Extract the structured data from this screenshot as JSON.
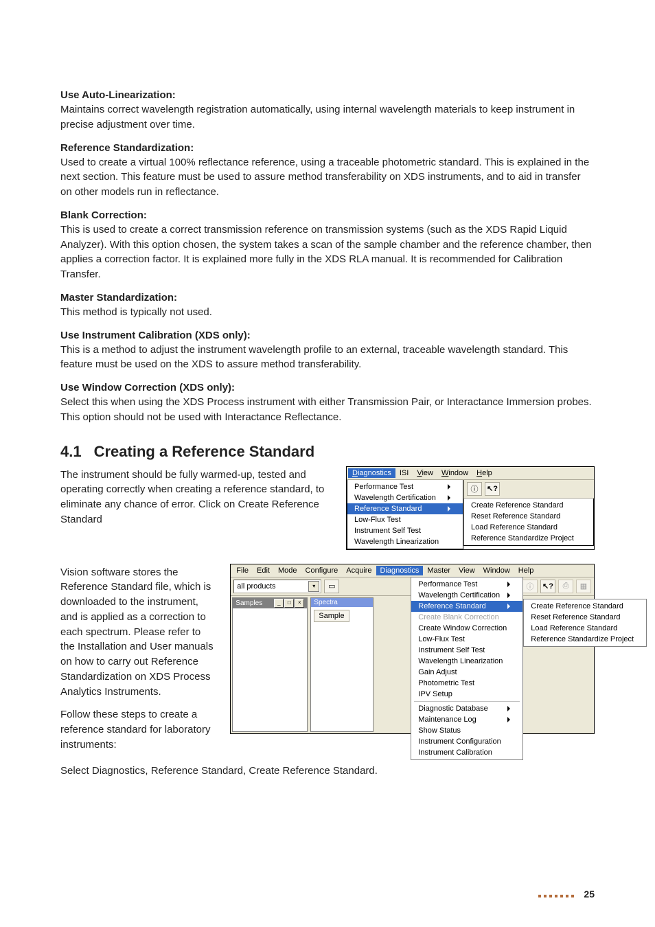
{
  "sections": {
    "auto_lin": {
      "head": "Use Auto-Linearization:",
      "body": "Maintains correct wavelength registration automatically, using internal wavelength materials to keep instrument in precise adjustment over time."
    },
    "ref_std_hdr": {
      "head": "Reference Standardization:",
      "body": "Used to create a virtual 100% reflectance reference, using a traceable photometric standard. This is explained in the next section. This feature must be used to assure method transferability on XDS instruments, and to aid in transfer on other models run in reflectance."
    },
    "blank": {
      "head": "Blank Correction:",
      "body": "This is used to create a correct transmission reference on transmission systems (such as the XDS Rapid Liquid Analyzer). With this option chosen, the system takes a scan of the sample chamber and the reference chamber, then applies a correction factor. It is explained more fully in the XDS RLA manual. It is recommended for Calibration Transfer."
    },
    "master": {
      "head": "Master Standardization:",
      "body": "This method is typically not used."
    },
    "inst_cal": {
      "head": "Use Instrument Calibration (XDS only):",
      "body": "This is a method to adjust the instrument wavelength profile to an external, traceable wavelength standard. This feature must be used on the XDS to assure method transferability."
    },
    "win_cor": {
      "head": "Use Window Correction (XDS only):",
      "body": "Select this when using the XDS Process instrument with either Transmission Pair, or Interactance Immersion probes. This option should not be used with Interactance Reflectance."
    }
  },
  "heading": {
    "num": "4.1",
    "title": "Creating a Reference Standard"
  },
  "para41a": "The instrument should be fully warmed-up, tested and operating correctly when creating a reference standard, to eliminate any chance of error. Click on Create Reference Standard",
  "para41b": "Vision software stores the Reference Standard file, which is downloaded to the instrument, and is applied as a correction to each spectrum. Please refer to the Installation and User manuals on how to carry out Reference Standardization on XDS Process Analytics Instruments.",
  "para41c": "Follow these steps to create a reference standard for laboratory instruments:",
  "para41d": "Select Diagnostics, Reference Standard, Create Reference Standard.",
  "fig1": {
    "menubar": [
      "Diagnostics",
      "ISI",
      "View",
      "Window",
      "Help"
    ],
    "menubar_ul": [
      "D",
      "",
      "V",
      "W",
      "H"
    ],
    "tb_icons": [
      "info-icon",
      "help-pointer-icon"
    ],
    "left_items": [
      {
        "label": "Performance Test",
        "arrow": true
      },
      {
        "label": "Wavelength Certification",
        "arrow": true
      },
      {
        "label": "Reference Standard",
        "arrow": true,
        "sel": true
      },
      {
        "label": "Low-Flux Test"
      },
      {
        "label": "Instrument Self Test"
      },
      {
        "label": "Wavelength Linearization"
      }
    ],
    "right_items": [
      "Create Reference Standard",
      "Reset Reference Standard",
      "Load Reference Standard",
      "Reference Standardize Project"
    ]
  },
  "fig2": {
    "menubar": [
      "File",
      "Edit",
      "Mode",
      "Configure",
      "Acquire",
      "Diagnostics",
      "Master",
      "View",
      "Window",
      "Help"
    ],
    "combo": "all products",
    "tb_left_icons": [
      "open-icon"
    ],
    "tb_right_icons": [
      "info-icon",
      "help-pointer-icon",
      "print-icon",
      "calc-icon"
    ],
    "pane1_title": "Samples",
    "pane2_title": "Spectra",
    "pane2_button": "Sample",
    "diag_items": [
      {
        "label": "Performance Test",
        "arrow": true
      },
      {
        "label": "Wavelength Certification",
        "arrow": true
      },
      {
        "label": "Reference Standard",
        "arrow": true,
        "sel": true
      },
      {
        "label": "Create Blank Correction",
        "disabled": true
      },
      {
        "label": "Create Window Correction"
      },
      {
        "label": "Low-Flux Test"
      },
      {
        "label": "Instrument Self Test"
      },
      {
        "label": "Wavelength Linearization"
      },
      {
        "label": "Gain Adjust"
      },
      {
        "label": "Photometric Test"
      },
      {
        "label": "IPV Setup"
      },
      {
        "sep": true
      },
      {
        "label": "Diagnostic Database",
        "arrow": true
      },
      {
        "label": "Maintenance Log",
        "arrow": true
      },
      {
        "label": "Show Status"
      },
      {
        "label": "Instrument Configuration"
      },
      {
        "label": "Instrument Calibration"
      }
    ],
    "sub_items": [
      "Create Reference Standard",
      "Reset Reference Standard",
      "Load Reference Standard",
      "Reference Standardize Project"
    ]
  },
  "page_number": "25"
}
